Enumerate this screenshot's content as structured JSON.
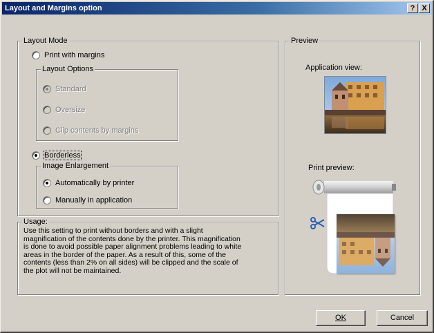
{
  "window": {
    "title": "Layout and Margins option",
    "help_label": "?",
    "close_label": "X"
  },
  "layout_mode": {
    "legend": "Layout Mode",
    "print_with_margins": {
      "label": "Print with margins",
      "selected": false
    },
    "layout_options": {
      "legend": "Layout Options",
      "standard": {
        "label": "Standard",
        "selected": true,
        "enabled": false
      },
      "oversize": {
        "label": "Oversize",
        "selected": false,
        "enabled": false
      },
      "clip_contents": {
        "label": "Clip contents by margins",
        "selected": false,
        "enabled": false
      }
    },
    "borderless": {
      "label": "Borderless",
      "selected": true
    },
    "image_enlargement": {
      "legend": "Image Enlargement",
      "auto": {
        "label": "Automatically by printer",
        "selected": true
      },
      "manual": {
        "label": "Manually in application",
        "selected": false
      }
    }
  },
  "usage": {
    "legend": "Usage:",
    "lines": [
      "Use this setting to print without borders and with a slight",
      "magnification of the contents done by the printer. This magnification",
      "is done to avoid possible paper alignment problems leading to white",
      "areas in the border of the paper. As a result of this, some of the",
      "contents (less than 2% on all sides) will be clipped and the scale of",
      "the plot will not be maintained."
    ]
  },
  "preview": {
    "legend": "Preview",
    "application_view_label": "Application view:",
    "print_preview_label": "Print preview:"
  },
  "buttons": {
    "ok": "OK",
    "cancel": "Cancel"
  },
  "icons": {
    "scissors": "scissors-icon",
    "paper_roll": "paper-roll-icon"
  },
  "colors": {
    "dialog_bg": "#d4d0c8",
    "title_start": "#0a246a",
    "title_end": "#a6caf0",
    "scissors": "#2a5fb0"
  }
}
